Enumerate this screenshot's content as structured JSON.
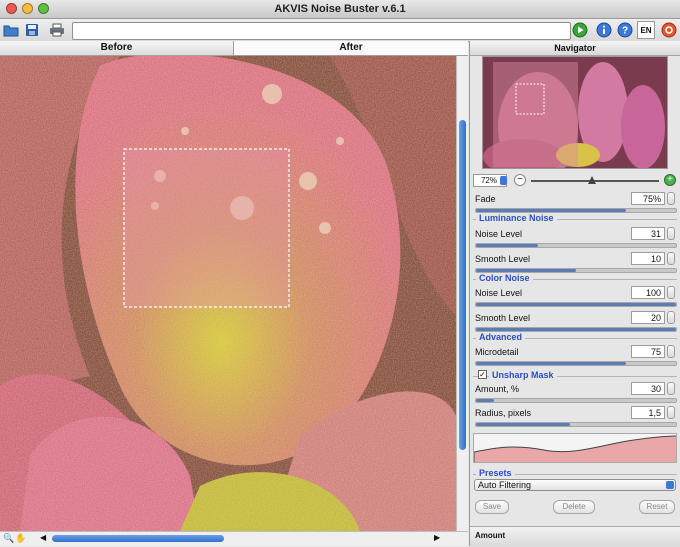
{
  "window": {
    "title": "AKVIS Noise Buster v.6.1"
  },
  "toolbar": {
    "language": "EN",
    "address_value": ""
  },
  "tabs": [
    {
      "label": "Before"
    },
    {
      "label": "After"
    }
  ],
  "navigator": {
    "title": "Navigator",
    "zoom": "72%",
    "zoom_level": 0.48
  },
  "fade": {
    "label": "Fade",
    "value": "75%",
    "level": 0.75
  },
  "luminance_noise": {
    "title": "Luminance Noise",
    "noise_level": {
      "label": "Noise Level",
      "value": "31",
      "level": 0.31
    },
    "smooth_level": {
      "label": "Smooth Level",
      "value": "10",
      "level": 0.5
    }
  },
  "color_noise": {
    "title": "Color Noise",
    "noise_level": {
      "label": "Noise Level",
      "value": "100",
      "level": 1.0
    },
    "smooth_level": {
      "label": "Smooth Level",
      "value": "20",
      "level": 1.0
    }
  },
  "advanced": {
    "title": "Advanced",
    "microdetail": {
      "label": "Microdetail",
      "value": "75",
      "level": 0.75
    }
  },
  "unsharp_mask": {
    "title": "Unsharp Mask",
    "checked": true,
    "amount": {
      "label": "Amount, %",
      "value": "30",
      "level": 0.09
    },
    "radius": {
      "label": "Radius, pixels",
      "value": "1,5",
      "level": 0.47
    }
  },
  "presets": {
    "title": "Presets",
    "selected": "Auto Filtering",
    "save_label": "Save",
    "delete_label": "Delete",
    "reset_label": "Reset"
  },
  "footer": {
    "amount_label": "Amount"
  },
  "colors": {
    "accent": "#2b4ec8",
    "slider_fill": "#5c7db3",
    "histogram_fill": "#e9a7a7"
  }
}
